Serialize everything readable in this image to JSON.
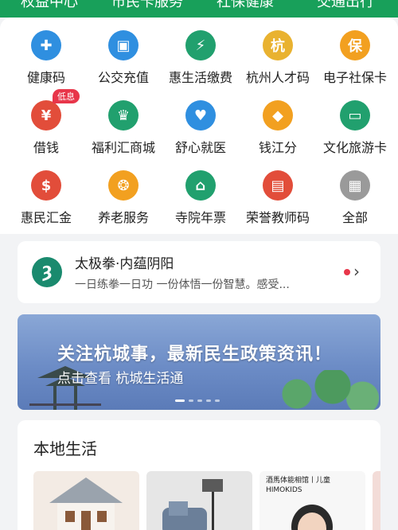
{
  "top_tabs": [
    "权益中心",
    "市民卡服务",
    "社保健康",
    "交通出行"
  ],
  "services": [
    {
      "label": "健康码",
      "icon": "heart-plus-icon",
      "color": "#2f8fe0",
      "glyph": "✚"
    },
    {
      "label": "公交充值",
      "icon": "bus-icon",
      "color": "#2f8fe0",
      "glyph": "▣"
    },
    {
      "label": "惠生活缴费",
      "icon": "bolt-drop-icon",
      "color": "#21a06e",
      "glyph": "⚡"
    },
    {
      "label": "杭州人才码",
      "icon": "talent-seal-icon",
      "color": "#e9b230",
      "glyph": "杭"
    },
    {
      "label": "电子社保卡",
      "icon": "social-security-card-icon",
      "color": "#f2a020",
      "glyph": "保"
    },
    {
      "label": "借钱",
      "icon": "borrow-money-icon",
      "color": "#e24d3a",
      "glyph": "¥",
      "badge": "低息"
    },
    {
      "label": "福利汇商城",
      "icon": "shopping-bag-icon",
      "color": "#21a06e",
      "glyph": "♛"
    },
    {
      "label": "舒心就医",
      "icon": "medical-heart-icon",
      "color": "#2f8fe0",
      "glyph": "♥"
    },
    {
      "label": "钱江分",
      "icon": "diamond-score-icon",
      "color": "#f2a020",
      "glyph": "◆"
    },
    {
      "label": "文化旅游卡",
      "icon": "travel-card-icon",
      "color": "#21a06e",
      "glyph": "▭"
    },
    {
      "label": "惠民汇金",
      "icon": "money-bag-icon",
      "color": "#e24d3a",
      "glyph": "$"
    },
    {
      "label": "养老服务",
      "icon": "elderly-care-icon",
      "color": "#f2a020",
      "glyph": "❂"
    },
    {
      "label": "寺院年票",
      "icon": "temple-icon",
      "color": "#21a06e",
      "glyph": "⌂"
    },
    {
      "label": "荣誉教师码",
      "icon": "teacher-card-icon",
      "color": "#e24d3a",
      "glyph": "▤"
    },
    {
      "label": "全部",
      "icon": "all-grid-icon",
      "color": "#9a9a9a",
      "glyph": "▦"
    }
  ],
  "notice": {
    "title": "太极拳·内蕴阴阳",
    "subtitle": "一日练拳一日功 一份体悟一份智慧。感受..."
  },
  "banner": {
    "headline": "关注杭城事，最新民生政策资讯！",
    "sub": "点击查看 杭城生活通",
    "page_index": 1,
    "page_count": 5
  },
  "local_life": {
    "title": "本地生活",
    "tiles": [
      {
        "kind": "house",
        "text": ""
      },
      {
        "kind": "furniture",
        "text": ""
      },
      {
        "kind": "kids",
        "text": "酒馬体能相馆丨儿童\nHIMOKIDS"
      }
    ]
  }
}
